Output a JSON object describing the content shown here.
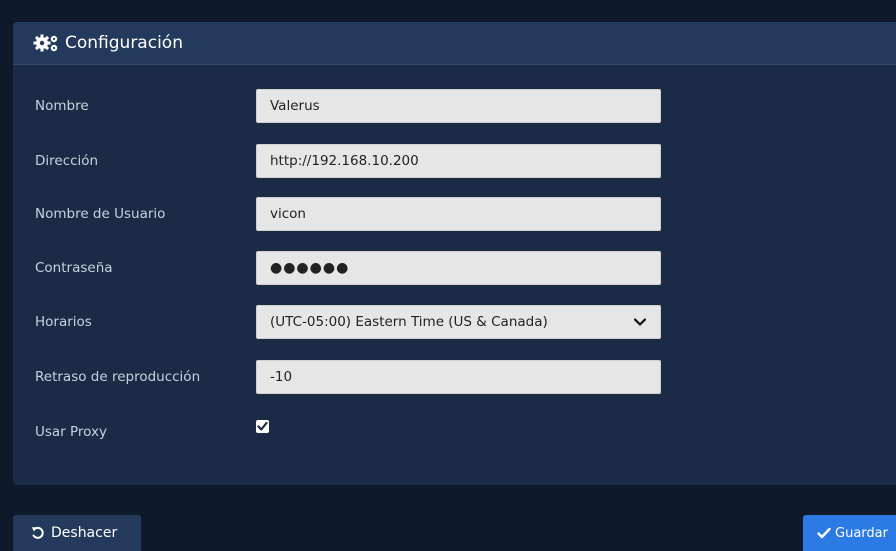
{
  "panel": {
    "title": "Configuración",
    "icon": "cogs-icon"
  },
  "form": {
    "nombre": {
      "label": "Nombre",
      "value": "Valerus"
    },
    "direccion": {
      "label": "Dirección",
      "value": "http://192.168.10.200"
    },
    "usuario": {
      "label": "Nombre de Usuario",
      "value": "vicon"
    },
    "contrasena": {
      "label": "Contraseña",
      "value": "●●●●●●"
    },
    "horarios": {
      "label": "Horarios",
      "value": "(UTC-05:00) Eastern Time (US & Canada)"
    },
    "retraso": {
      "label": "Retraso de reproducción",
      "value": "-10"
    },
    "proxy": {
      "label": "Usar Proxy",
      "checked": true
    }
  },
  "actions": {
    "undo_label": "Deshacer",
    "save_label": "Guardar"
  },
  "colors": {
    "background": "#0e1a2b",
    "panel": "#1b2b45",
    "header": "#243a5c",
    "accent": "#2c7be5"
  }
}
